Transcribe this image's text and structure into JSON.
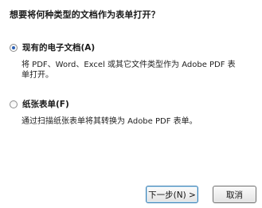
{
  "dialog": {
    "question": "想要将何种类型的文档作为表单打开？",
    "options": [
      {
        "label": "现有的电子文档(A)",
        "description": "将 PDF、Word、Excel 或其它文件类型作为 Adobe PDF 表单打开。",
        "selected": true
      },
      {
        "label": "纸张表单(F)",
        "description": "通过扫描纸张表单将其转换为 Adobe PDF 表单。",
        "selected": false
      }
    ],
    "buttons": {
      "next": "下一步(N) >",
      "cancel": "取消"
    },
    "accent_color": "#2a5fb5"
  }
}
